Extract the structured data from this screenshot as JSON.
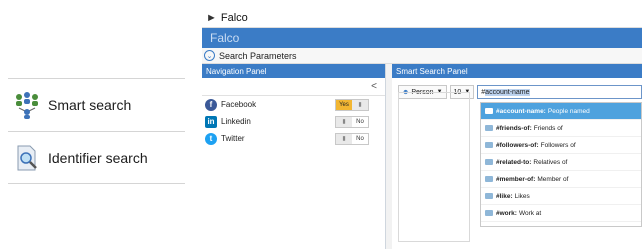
{
  "left_menu": {
    "items": [
      {
        "label": "Smart search",
        "icon": "people-network-icon"
      },
      {
        "label": "Identifier search",
        "icon": "document-magnifier-icon"
      }
    ]
  },
  "window": {
    "title": "Falco",
    "app_name": "Falco",
    "search_parameters_label": "Search Parameters"
  },
  "nav_panel": {
    "header": "Navigation Panel",
    "collapse_symbol": "<",
    "networks": [
      {
        "label": "Facebook",
        "yes": "Yes",
        "no": "",
        "state": "on",
        "color": "#3b5998",
        "letter": "f"
      },
      {
        "label": "Linkedin",
        "yes": "",
        "no": "No",
        "state": "off",
        "color": "#0077b5",
        "letter": "in"
      },
      {
        "label": "Twitter",
        "yes": "",
        "no": "No",
        "state": "off",
        "color": "#1da1f2",
        "letter": "t"
      }
    ]
  },
  "search_panel": {
    "header": "Smart Search Panel",
    "entity_select": "Person",
    "count_select": "10",
    "query_prefix": "#",
    "query_highlight": "account-name",
    "suggestions": [
      {
        "keyword": "#account-name:",
        "text": "People named",
        "active": true
      },
      {
        "keyword": "#friends-of:",
        "text": "Friends of",
        "active": false
      },
      {
        "keyword": "#followers-of:",
        "text": "Followers of",
        "active": false
      },
      {
        "keyword": "#related-to:",
        "text": "Relatives of",
        "active": false
      },
      {
        "keyword": "#member-of:",
        "text": "Member of",
        "active": false
      },
      {
        "keyword": "#like:",
        "text": "Likes",
        "active": false
      },
      {
        "keyword": "#work:",
        "text": "Work at",
        "active": false
      }
    ]
  }
}
